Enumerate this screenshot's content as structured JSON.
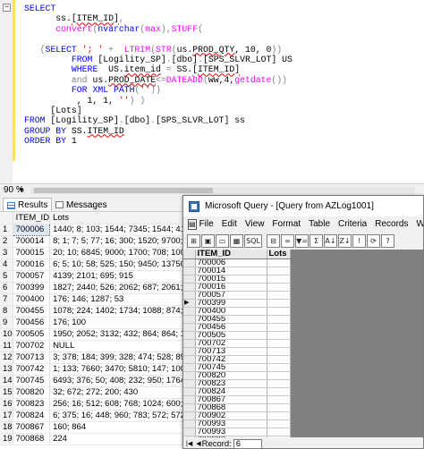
{
  "editor": {
    "collapse_glyph": "−",
    "lines": [
      [
        {
          "t": "SELECT",
          "c": "kw"
        }
      ],
      [
        {
          "t": "      ss.",
          "c": ""
        },
        {
          "t": "[ITEM_ID]",
          "c": "sq"
        },
        {
          "t": ",",
          "c": "gr"
        }
      ],
      [
        {
          "t": "      ",
          "c": ""
        },
        {
          "t": "convert",
          "c": "fn"
        },
        {
          "t": "(",
          "c": "gr"
        },
        {
          "t": "nvarchar",
          "c": "kw"
        },
        {
          "t": "(",
          "c": "gr"
        },
        {
          "t": "max",
          "c": "fn"
        },
        {
          "t": "),",
          "c": "gr"
        },
        {
          "t": "STUFF",
          "c": "fn"
        },
        {
          "t": "(",
          "c": "gr"
        }
      ],
      [
        {
          "t": "",
          "c": ""
        }
      ],
      [
        {
          "t": "   ",
          "c": ""
        },
        {
          "t": "(",
          "c": "gr"
        },
        {
          "t": "SELECT",
          "c": "kw"
        },
        {
          "t": " '; ' ",
          "c": "st"
        },
        {
          "t": "+",
          "c": "gr"
        },
        {
          "t": "  ",
          "c": ""
        },
        {
          "t": "LTRIM",
          "c": "fn"
        },
        {
          "t": "(",
          "c": "gr"
        },
        {
          "t": "STR",
          "c": "fn"
        },
        {
          "t": "(",
          "c": "gr"
        },
        {
          "t": "us.",
          "c": ""
        },
        {
          "t": "PROD_QTY",
          "c": "sq"
        },
        {
          "t": ", 10, 0",
          "c": ""
        },
        {
          "t": "))",
          "c": "gr"
        }
      ],
      [
        {
          "t": "         ",
          "c": ""
        },
        {
          "t": "FROM",
          "c": "kw"
        },
        {
          "t": " [Logility_SP]",
          "c": ""
        },
        {
          "t": ".",
          "c": "gr"
        },
        {
          "t": "[dbo]",
          "c": ""
        },
        {
          "t": ".",
          "c": "gr"
        },
        {
          "t": "[SPS_SLVR_LOT] US",
          "c": ""
        }
      ],
      [
        {
          "t": "         ",
          "c": ""
        },
        {
          "t": "WHERE",
          "c": "kw"
        },
        {
          "t": "  US.",
          "c": ""
        },
        {
          "t": "item_id",
          "c": "sq"
        },
        {
          "t": " = ",
          "c": "gr"
        },
        {
          "t": "SS.",
          "c": ""
        },
        {
          "t": "[ITEM_ID]",
          "c": "sq"
        }
      ],
      [
        {
          "t": "         ",
          "c": ""
        },
        {
          "t": "and",
          "c": "gr"
        },
        {
          "t": " us.",
          "c": ""
        },
        {
          "t": "PROD_DATE",
          "c": "sq"
        },
        {
          "t": "<=",
          "c": "gr"
        },
        {
          "t": "DATEADD",
          "c": "fn"
        },
        {
          "t": "(",
          "c": "gr"
        },
        {
          "t": "ww,4,",
          "c": ""
        },
        {
          "t": "getdate",
          "c": "fn"
        },
        {
          "t": "())",
          "c": "gr"
        }
      ],
      [
        {
          "t": "         ",
          "c": ""
        },
        {
          "t": "FOR",
          "c": "kw"
        },
        {
          "t": " ",
          "c": ""
        },
        {
          "t": "XML",
          "c": "kw"
        },
        {
          "t": " ",
          "c": ""
        },
        {
          "t": "PATH",
          "c": "kw"
        },
        {
          "t": "(",
          "c": "gr"
        },
        {
          "t": "''",
          "c": "st"
        },
        {
          "t": "))",
          "c": "gr"
        }
      ],
      [
        {
          "t": "          , 1, 1, ",
          "c": ""
        },
        {
          "t": "''",
          "c": "st"
        },
        {
          "t": ") )",
          "c": "gr"
        }
      ],
      [
        {
          "t": "     [Lots]",
          "c": ""
        }
      ],
      [
        {
          "t": "FROM",
          "c": "kw"
        },
        {
          "t": " [Logility_SP]",
          "c": ""
        },
        {
          "t": ".",
          "c": "gr"
        },
        {
          "t": "[dbo]",
          "c": ""
        },
        {
          "t": ".",
          "c": "gr"
        },
        {
          "t": "[SPS_SLVR_LOT] ss",
          "c": ""
        }
      ],
      [
        {
          "t": "GROUP BY",
          "c": "kw"
        },
        {
          "t": " SS.",
          "c": ""
        },
        {
          "t": "ITEM_ID",
          "c": "sq"
        }
      ],
      [
        {
          "t": "ORDER BY",
          "c": "kw"
        },
        {
          "t": " 1",
          "c": ""
        }
      ]
    ]
  },
  "status": {
    "zoom": "90 %",
    "zoom_caret": "▼"
  },
  "tabs": {
    "results_label": "Results",
    "messages_label": "Messages"
  },
  "results": {
    "columns": [
      "ITEM_ID",
      "Lots"
    ],
    "rows": [
      [
        "1",
        "700006",
        "1440; 8; 103; 1544; 7345; 1544; 4181; 5"
      ],
      [
        "2",
        "700014",
        "8; 1; 7; 5; 77; 16; 300; 1520; 9700; 1399"
      ],
      [
        "3",
        "700015",
        "20; 10; 6845; 9000; 1700; 708; 1009; 10"
      ],
      [
        "4",
        "700016",
        "6; 5; 10; 58; 525; 150; 9450; 13750; 138"
      ],
      [
        "5",
        "700057",
        "4139; 2101; 695; 915"
      ],
      [
        "6",
        "700399",
        "1827; 2440; 526; 2062; 687; 2061; 4809"
      ],
      [
        "7",
        "700400",
        "176; 146; 1287; 53"
      ],
      [
        "8",
        "700455",
        "1078; 224; 1402; 1734; 1088; 874; 237"
      ],
      [
        "9",
        "700456",
        "176; 100"
      ],
      [
        "10",
        "700505",
        "1950; 2052; 3132; 432; 864; 864; 1080;"
      ],
      [
        "11",
        "700702",
        "NULL"
      ],
      [
        "12",
        "700713",
        "3; 378; 184; 399; 328; 474; 528; 892"
      ],
      [
        "13",
        "700742",
        "1; 133; 7660; 3470; 5810; 147; 1000; 18"
      ],
      [
        "14",
        "700745",
        "6493; 376; 50; 408; 232; 950; 1764; 126"
      ],
      [
        "15",
        "700820",
        "32; 672; 272; 200; 430"
      ],
      [
        "16",
        "700823",
        "256; 16; 512; 608; 768; 1024; 600; 1290"
      ],
      [
        "17",
        "700824",
        "6; 375; 16; 448; 960; 783; 572; 572"
      ],
      [
        "18",
        "700867",
        "160; 864"
      ],
      [
        "19",
        "700868",
        "224"
      ]
    ]
  },
  "msquery": {
    "title": "Microsoft Query - [Query from AZLog1001]",
    "doc_icon": "▤",
    "menu": [
      "File",
      "Edit",
      "View",
      "Format",
      "Table",
      "Criteria",
      "Records",
      "Window",
      "H"
    ],
    "toolbar": [
      "⊞",
      "▣",
      "▭",
      "▦",
      "SQL",
      "",
      "⊟",
      "∞",
      "▼=",
      "Σ",
      "A↓",
      "Z↓",
      "!",
      "⟳",
      "?"
    ],
    "columns": [
      "ITEM_ID",
      "Lots"
    ],
    "pointer_glyph": "▶",
    "item_ids": [
      "700006",
      "700014",
      "700015",
      "700016",
      "700057",
      "700399",
      "700400",
      "700455",
      "700456",
      "700505",
      "700702",
      "700713",
      "700742",
      "700745",
      "700820",
      "700823",
      "700824",
      "700867",
      "700868",
      "700902",
      "700993",
      "700993",
      "700999"
    ],
    "record_label": "Record:",
    "record_value": "6",
    "nav": [
      "|◀",
      "◀"
    ]
  }
}
